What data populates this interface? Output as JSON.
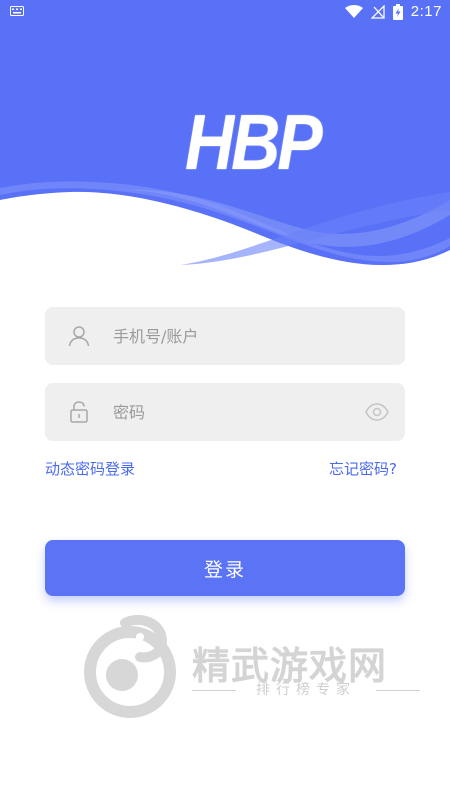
{
  "status_bar": {
    "time": "2:17"
  },
  "logo": {
    "text": "HBP"
  },
  "account_field": {
    "placeholder": "手机号/账户",
    "value": ""
  },
  "password_field": {
    "placeholder": "密码",
    "value": ""
  },
  "links": {
    "dynamic_login": "动态密码登录",
    "forgot_password": "忘记密码?"
  },
  "login_button": {
    "label": "登录"
  },
  "watermark": {
    "title": "精武游戏网",
    "subtitle": "排行榜专家"
  },
  "colors": {
    "accent": "#5b74f6",
    "link": "#4a6af0",
    "field_bg": "#efefef"
  }
}
